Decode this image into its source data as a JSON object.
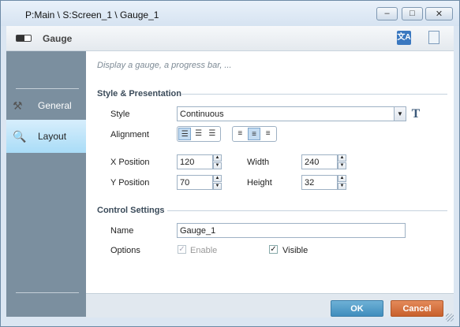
{
  "window": {
    "title": "P:Main \\ S:Screen_1 \\ Gauge_1",
    "controls": {
      "minimize": "▭",
      "maximize": "◻",
      "close": "✕"
    }
  },
  "header": {
    "title": "Gauge",
    "icons": [
      "gauge-icon",
      "translate-icon",
      "page-icon"
    ]
  },
  "sidebar": {
    "items": [
      {
        "label": "General",
        "icon": "tools-icon"
      },
      {
        "label": "Layout",
        "icon": "magnifier-icon"
      }
    ],
    "active": "Layout"
  },
  "description": "Display a gauge, a progress bar, ...",
  "style_section": {
    "title": "Style & Presentation",
    "style_label": "Style",
    "style_value": "Continuous",
    "text_style_button": "T",
    "alignment_label": "Alignment",
    "x_label": "X Position",
    "x_value": "120",
    "y_label": "Y Position",
    "y_value": "70",
    "width_label": "Width",
    "width_value": "240",
    "height_label": "Height",
    "height_value": "32"
  },
  "control_section": {
    "title": "Control Settings",
    "name_label": "Name",
    "name_value": "Gauge_1",
    "options_label": "Options",
    "enable_label": "Enable",
    "enable_checked": true,
    "enable_disabled": true,
    "visible_label": "Visible",
    "visible_checked": true
  },
  "footer": {
    "ok_label": "OK",
    "cancel_label": "Cancel"
  },
  "colors": {
    "ok": "#4a97c6",
    "cancel": "#d16b36",
    "sidebar": "#7b8f9f",
    "active_tab": "#b9e3f8"
  }
}
